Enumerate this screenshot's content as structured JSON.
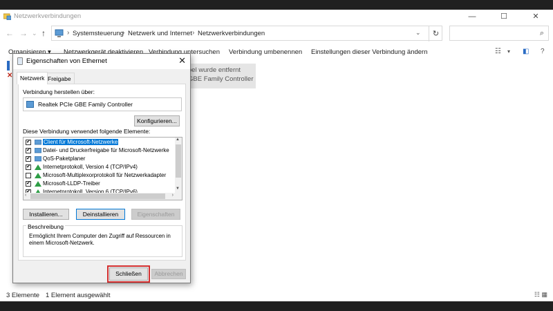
{
  "window": {
    "title": "Netzwerkverbindungen",
    "minimize": "—",
    "maximize": "☐",
    "close": "✕"
  },
  "nav": {
    "back": "←",
    "forward": "→",
    "recent": "⌄",
    "up": "↑"
  },
  "address": {
    "crumbs": [
      "Systemsteuerung",
      "Netzwerk und Internet",
      "Netzwerkverbindungen"
    ],
    "separator": "›",
    "dropdown": "⌄",
    "refresh": "↻"
  },
  "search": {
    "placeholder": "",
    "icon": "⌕"
  },
  "commandbar": {
    "items": [
      "Organisieren ▾",
      "Netzwerkgerät deaktivieren",
      "Verbindung untersuchen",
      "Verbindung umbenennen",
      "Einstellungen dieser Verbindung ändern"
    ],
    "view_icon": "☷",
    "view_drop": "▾",
    "pane_icon": "◧",
    "help_icon": "?"
  },
  "content": {
    "bg_item_line1": "bel wurde entfernt",
    "bg_item_line2": "GBE Family Controller"
  },
  "statusbar": {
    "count": "3 Elemente",
    "selected": "1 Element ausgewählt",
    "icons": "☷ ▦"
  },
  "dialog": {
    "title": "Eigenschaften von Ethernet",
    "close": "✕",
    "tabs": [
      "Netzwerk",
      "Freigabe"
    ],
    "connect_label": "Verbindung herstellen über:",
    "adapter": "Realtek PCIe GBE Family Controller",
    "configure_button": "Konfigurieren...",
    "elements_label": "Diese Verbindung verwendet folgende Elemente:",
    "items": [
      {
        "label": "Client für Microsoft-Netzwerke",
        "checked": "✔",
        "selected": true
      },
      {
        "label": "Datei- und Druckerfreigabe für Microsoft-Netzwerke",
        "checked": "✔"
      },
      {
        "label": "QoS-Paketplaner",
        "checked": "✔"
      },
      {
        "label": "Internetprotokoll, Version 4 (TCP/IPv4)",
        "checked": "✔"
      },
      {
        "label": "Microsoft-Multiplexorprotokoll für Netzwerkadapter",
        "checked": ""
      },
      {
        "label": "Microsoft-LLDP-Treiber",
        "checked": "✔"
      },
      {
        "label": "Internetprotokoll, Version 6 (TCP/IPv6)",
        "checked": "✔"
      }
    ],
    "scroll_up": "▲",
    "scroll_down": "▼",
    "scroll_left": "‹",
    "scroll_right": "›",
    "install_button": "Installieren...",
    "uninstall_button": "Deinstallieren",
    "properties_button": "Eigenschaften",
    "description_legend": "Beschreibung",
    "description_text": "Ermöglicht Ihrem Computer den Zugriff auf Ressourcen in einem Microsoft-Netzwerk.",
    "close_button": "Schließen",
    "cancel_button": "Abbrechen"
  },
  "colors": {
    "accent": "#0078d7",
    "highlight": "#d32f2f"
  }
}
